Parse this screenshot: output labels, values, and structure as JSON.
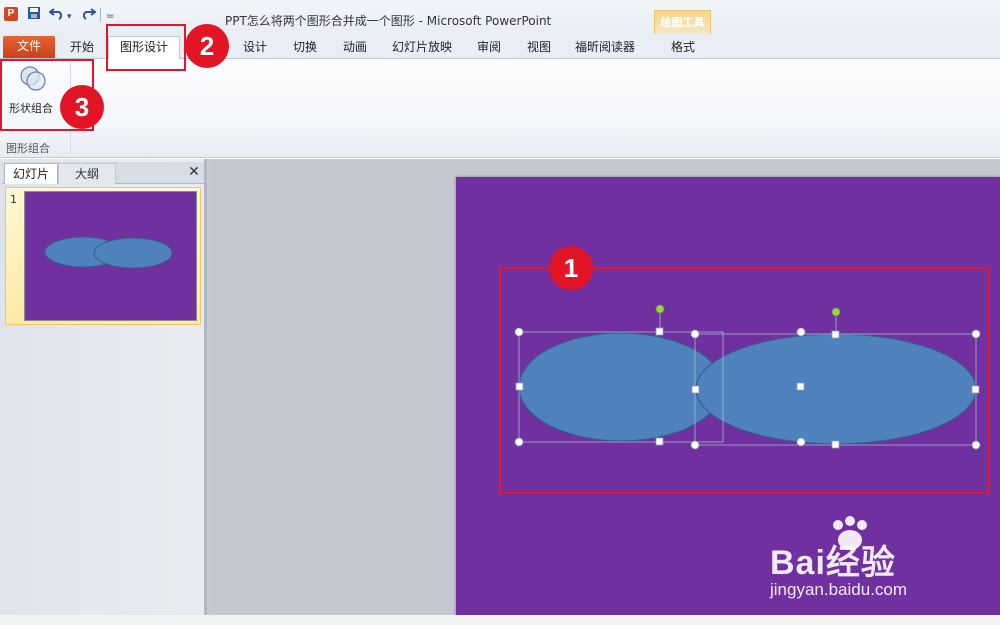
{
  "window": {
    "title": "PPT怎么将两个图形合并成一个图形 - Microsoft PowerPoint",
    "app_icon": "P",
    "quick_access": [
      "save-icon",
      "undo-icon",
      "redo-icon"
    ]
  },
  "context_tab_group": {
    "label": "绘图工具"
  },
  "tabs": {
    "file": "文件",
    "home": "开始",
    "active": "图形设计",
    "items": [
      "设计",
      "切换",
      "动画",
      "幻灯片放映",
      "审阅",
      "视图",
      "福昕阅读器"
    ],
    "format": "格式"
  },
  "ribbon": {
    "command": {
      "label": "形状组合",
      "icon": "shape-combine-icon"
    },
    "group_label": "图形组合"
  },
  "left_pane": {
    "tabs": [
      "幻灯片",
      "大纲"
    ],
    "close_glyph": "✕",
    "slide_number": "1"
  },
  "annotations": [
    "1",
    "2",
    "3"
  ],
  "colors": {
    "slide_bg": "#7030a0",
    "ellipse_fill": "#4f81bd",
    "ellipse_stroke": "#385d8a",
    "annotation_red": "#e0162b",
    "file_tab": "#d24726"
  },
  "watermark": {
    "brand": "Bai经验",
    "url": "jingyan.baidu.com"
  }
}
